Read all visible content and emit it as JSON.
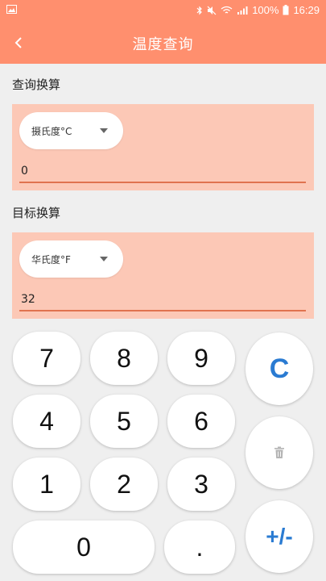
{
  "status_bar": {
    "battery": "100%",
    "time": "16:29",
    "icons": [
      "gallery-icon",
      "bluetooth-icon",
      "mute-icon",
      "wifi-icon",
      "signal-icon",
      "battery-icon"
    ]
  },
  "app_bar": {
    "title": "温度查询",
    "back_icon": "chevron-left-icon"
  },
  "query": {
    "label": "查询换算",
    "unit": "摄氏度°C",
    "value": "0"
  },
  "target": {
    "label": "目标换算",
    "unit": "华氏度°F",
    "value": "32"
  },
  "keypad": {
    "k7": "7",
    "k8": "8",
    "k9": "9",
    "k4": "4",
    "k5": "5",
    "k6": "6",
    "k1": "1",
    "k2": "2",
    "k3": "3",
    "k0": "0",
    "dot": ".",
    "clear": "C",
    "delete_icon": "trash-icon",
    "sign": "+/-"
  },
  "colors": {
    "accent": "#ff8f6e",
    "panel": "#fcc8b6",
    "underline": "#e0734f",
    "key_blue": "#2a7bd2"
  }
}
